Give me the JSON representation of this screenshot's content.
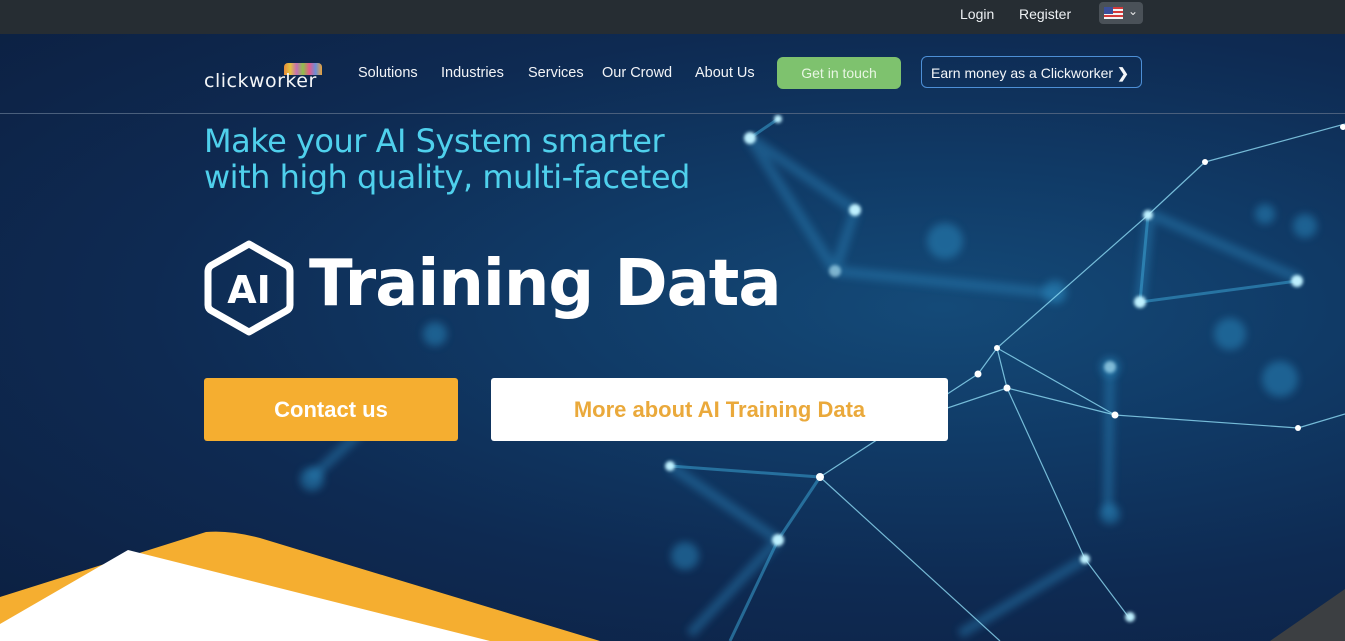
{
  "topbar": {
    "login": "Login",
    "register": "Register",
    "language": "US English"
  },
  "header": {
    "logo_text": "clickworker",
    "nav": [
      "Solutions",
      "Industries",
      "Services",
      "Our Crowd",
      "About Us"
    ],
    "cta_touch": "Get in touch",
    "cta_earn": "Earn money as a Clickworker",
    "cta_earn_arrow": "❯"
  },
  "hero": {
    "subheading_line1": "Make your AI System smarter",
    "subheading_line2": "with high quality, multi-faceted",
    "badge_text": "AI",
    "title": "Training Data",
    "button_contact": "Contact us",
    "button_more": "More about AI Training Data"
  },
  "colors": {
    "accent_orange": "#f5ae30",
    "accent_green": "#7ec26e",
    "subheading_cyan": "#4fd0ec",
    "topbar": "#262d33",
    "hero_bg": "#0e2a52"
  }
}
